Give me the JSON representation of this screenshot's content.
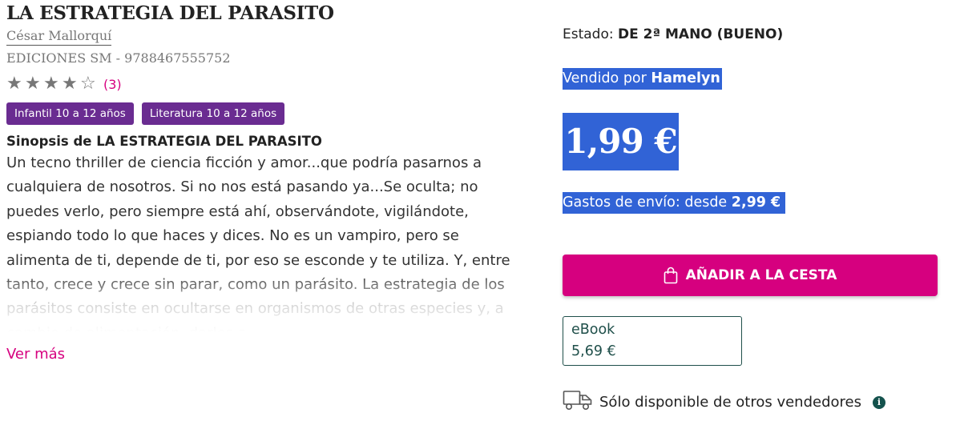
{
  "book": {
    "title": "LA ESTRATEGIA DEL PARASITO",
    "author": "César Mallorquí",
    "publisher_isbn": "EDICIONES SM - 9788467555752",
    "rating": {
      "stars": 4,
      "max": 5,
      "count": "(3)"
    },
    "tags": [
      "Infantil 10 a 12 años",
      "Literatura 10 a 12 años"
    ],
    "synopsis_title": "Sinopsis de LA ESTRATEGIA DEL PARASITO",
    "synopsis": "Un tecno thriller de ciencia ficción y amor...que podría pasarnos a cualquiera de nosotros. Si no nos está pasando ya...Se oculta; no puedes verlo, pero siempre está ahí, observándote, vigilándote, espiando todo lo que haces y dices. No es un vampiro, pero se alimenta de ti, depende de ti, por eso se esconde y te utiliza. Y, entre tanto, crece y crece sin parar, como un parásito. La estrategia de los parásitos consiste en ocultarse en organismos de otras especies y, a cambio de alimentación, darles a",
    "ver_mas": "Ver más"
  },
  "offer": {
    "estado_label": "Estado:",
    "estado_value": "DE 2ª MANO (BUENO)",
    "vendido_label": "Vendido por",
    "vendido_seller": "Hamelyn",
    "price": "1,99 €",
    "envio_label": "Gastos de envío: desde",
    "envio_value": "2,99 €",
    "add_to_cart": "AÑADIR A LA CESTA",
    "ebook_label": "eBook",
    "ebook_price": "5,69 €",
    "availability": "Sólo disponible de otros vendedores",
    "info_glyph": "i"
  },
  "colors": {
    "accent": "#d6007f",
    "tag": "#6a2c91",
    "highlight": "#3163d6",
    "ebook_border": "#1f4f4a"
  },
  "icons": [
    "star-icon",
    "shopping-bag-icon",
    "delivery-truck-icon",
    "info-icon"
  ]
}
